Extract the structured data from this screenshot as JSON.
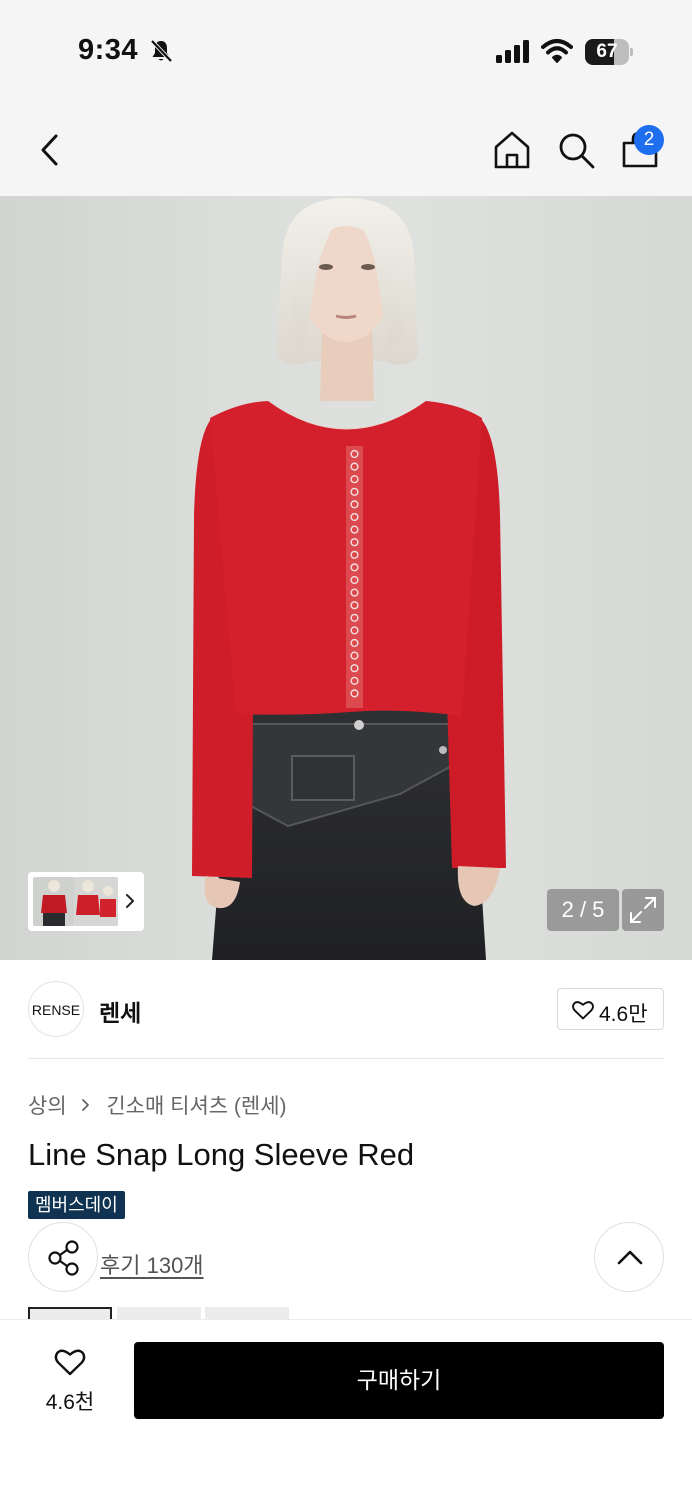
{
  "status_bar": {
    "time": "9:34",
    "battery_level": "67",
    "icons": [
      "bell-slash-icon",
      "signal-icon",
      "wifi-icon",
      "battery-icon"
    ]
  },
  "nav": {
    "icons": [
      "back-arrow-icon",
      "home-icon",
      "search-icon",
      "shopping-bag-icon"
    ],
    "cart_count": "2"
  },
  "gallery": {
    "counter": "2 / 5",
    "icons": [
      "chevron-right-icon",
      "expand-icon"
    ]
  },
  "brand": {
    "logo_text": "RENSE",
    "name": "렌세",
    "like_count": "4.6만"
  },
  "breadcrumb": {
    "category": "상의",
    "subcategory": "긴소매 티셔츠 (렌세)"
  },
  "product": {
    "title": "Line Snap Long Sleeve Red",
    "badge": "멤버스데이",
    "reviews_label": "후기 130개"
  },
  "bottom_bar": {
    "wish_count": "4.6천",
    "buy_label": "구매하기"
  },
  "colors": {
    "accent_badge": "#1e6ef0",
    "member_badge": "#0f3350",
    "buy_button": "#000000"
  }
}
